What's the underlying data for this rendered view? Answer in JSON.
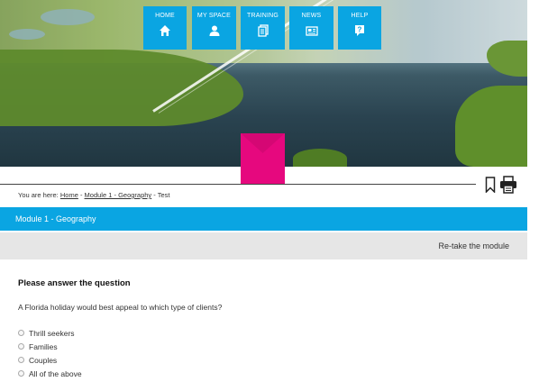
{
  "nav": {
    "items": [
      {
        "label": "HOME",
        "icon": "home-icon"
      },
      {
        "label": "MY SPACE",
        "icon": "user-icon"
      },
      {
        "label": "TRAINING",
        "icon": "documents-icon"
      },
      {
        "label": "NEWS",
        "icon": "newspaper-icon"
      },
      {
        "label": "HELP",
        "icon": "question-icon"
      }
    ]
  },
  "breadcrumb": {
    "prefix": "You are here:",
    "home": "Home",
    "module": "Module 1 - Geography",
    "current": "Test"
  },
  "module_bar": {
    "title": "Module 1 - Geography"
  },
  "retake": {
    "label": "Re-take the module"
  },
  "question": {
    "heading": "Please answer the question",
    "text": "A Florida holiday would best appeal to which type of clients?",
    "options": [
      "Thrill seekers",
      "Families",
      "Couples",
      "All of the above"
    ]
  },
  "colors": {
    "accent": "#0aa5e2",
    "brand_pink": "#e6087e",
    "retake_bg": "#e6e6e6"
  }
}
